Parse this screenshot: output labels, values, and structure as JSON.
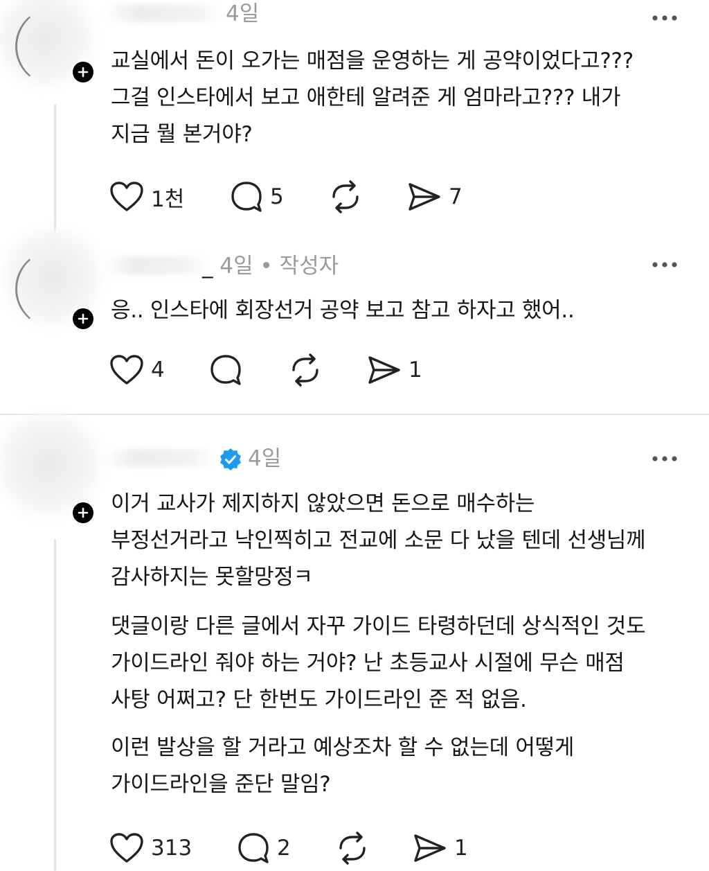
{
  "posts": [
    {
      "time": "4일",
      "author_tag": "",
      "verified": false,
      "paragraphs": [
        "교실에서 돈이 오가는 매점을 운영하는 게 공약이었다고???\n그걸 인스타에서 보고 애한테 알려준 게 엄마라고??? 내가\n지금 뭘 본거야?"
      ],
      "likes": "1천",
      "replies": "5",
      "reposts": "",
      "shares": "7"
    },
    {
      "time": "4일",
      "author_tag": "작성자",
      "verified": false,
      "paragraphs": [
        "응.. 인스타에 회장선거 공약 보고 참고 하자고 했어.."
      ],
      "likes": "4",
      "replies": "",
      "reposts": "",
      "shares": "1"
    },
    {
      "time": "4일",
      "author_tag": "",
      "verified": true,
      "paragraphs": [
        "이거 교사가 제지하지 않았으면 돈으로 매수하는\n부정선거라고 낙인찍히고 전교에 소문 다 났을 텐데 선생님께\n감사하지는 못할망정ㅋ",
        "댓글이랑 다른 글에서 자꾸 가이드 타령하던데 상식적인 것도\n가이드라인 줘야 하는 거야? 난 초등교사 시절에 무슨 매점\n사탕 어쩌고? 단 한번도 가이드라인 준 적 없음.",
        "이런 발상을 할 거라고 예상조차 할 수 없는데 어떻게\n가이드라인을 준단 말임?"
      ],
      "likes": "313",
      "replies": "2",
      "reposts": "",
      "shares": "1"
    }
  ],
  "icons": {
    "like": "heart-icon",
    "reply": "comment-icon",
    "repost": "repost-icon",
    "share": "send-icon",
    "more": "more-icon",
    "verified": "verified-badge-icon",
    "follow": "plus-icon"
  },
  "colors": {
    "verified": "#1d9bf0",
    "meta": "#9a9a9a",
    "divider": "#e6e6e6"
  }
}
